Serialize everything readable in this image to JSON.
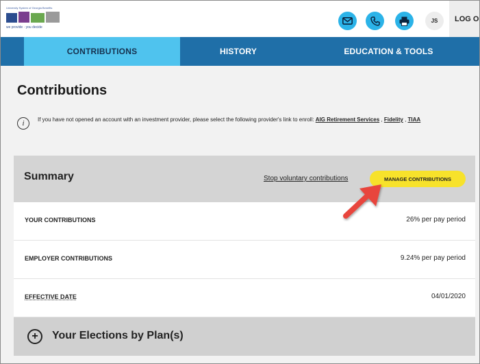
{
  "header": {
    "logo_org": "University System of Georgia Benefits",
    "logo_tagline": "we provide · you decide",
    "icons": [
      "mail-icon",
      "phone-icon",
      "print-icon"
    ],
    "avatar_initials": "JS",
    "logout_label": "LOG OU"
  },
  "nav": {
    "tabs": [
      {
        "label": "CONTRIBUTIONS",
        "active": true
      },
      {
        "label": "HISTORY",
        "active": false
      },
      {
        "label": "EDUCATION & TOOLS",
        "active": false
      }
    ]
  },
  "page": {
    "title": "Contributions",
    "info_text": "If you have not opened an account with an investment provider, please select the following provider's link to enroll:",
    "provider_links": [
      "AIG Retirement Services",
      "Fidelity",
      "TIAA"
    ]
  },
  "summary": {
    "heading": "Summary",
    "stop_link": "Stop voluntary contributions",
    "manage_button": "MANAGE CONTRIBUTIONS",
    "rows": [
      {
        "label": "YOUR CONTRIBUTIONS",
        "value": "26% per pay period"
      },
      {
        "label": "EMPLOYER CONTRIBUTIONS",
        "value": "9.24% per pay period"
      },
      {
        "label": "EFFECTIVE DATE",
        "value": "04/01/2020"
      }
    ]
  },
  "elections": {
    "label": "Your Elections by Plan(s)"
  },
  "colors": {
    "nav_bg": "#1f6fa8",
    "nav_active": "#4fc3ee",
    "icon_blue": "#2bb3e8",
    "manage_yellow": "#f7e22b",
    "arrow_red": "#e8453c"
  }
}
